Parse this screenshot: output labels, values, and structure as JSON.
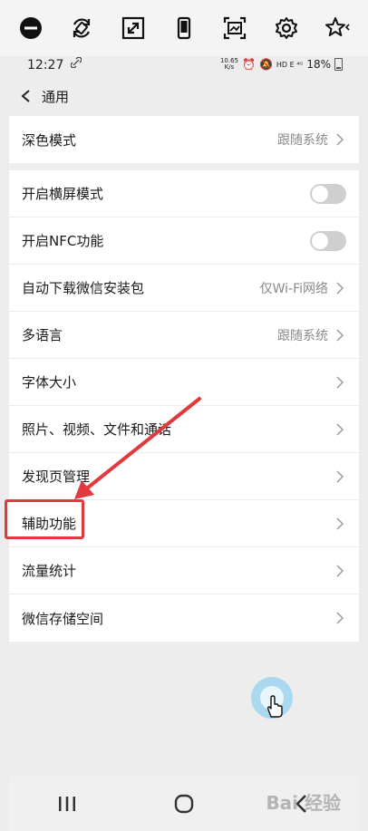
{
  "statusbar": {
    "time": "12:27",
    "speed_top": "10.65",
    "speed_bottom": "K/s",
    "indicators": "HD E ⁴ᴳ",
    "battery": "18%"
  },
  "navbar": {
    "title": "通用"
  },
  "group1": [
    {
      "label": "深色模式",
      "value": "跟随系统"
    }
  ],
  "group2": [
    {
      "label": "开启横屏模式",
      "type": "toggle",
      "on": false
    },
    {
      "label": "开启NFC功能",
      "type": "toggle",
      "on": false
    },
    {
      "label": "自动下载微信安装包",
      "value": "仅Wi-Fi网络"
    },
    {
      "label": "多语言",
      "value": "跟随系统"
    },
    {
      "label": "字体大小",
      "value": ""
    },
    {
      "label": "照片、视频、文件和通话",
      "value": ""
    },
    {
      "label": "发现页管理",
      "value": ""
    },
    {
      "label": "辅助功能",
      "value": ""
    },
    {
      "label": "流量统计",
      "value": ""
    },
    {
      "label": "微信存储空间",
      "value": ""
    }
  ],
  "colors": {
    "highlight": "#e0393e",
    "toggle_off": "#cfcfcf",
    "float": "#a9d8ef"
  },
  "watermark": "Bai 经验"
}
